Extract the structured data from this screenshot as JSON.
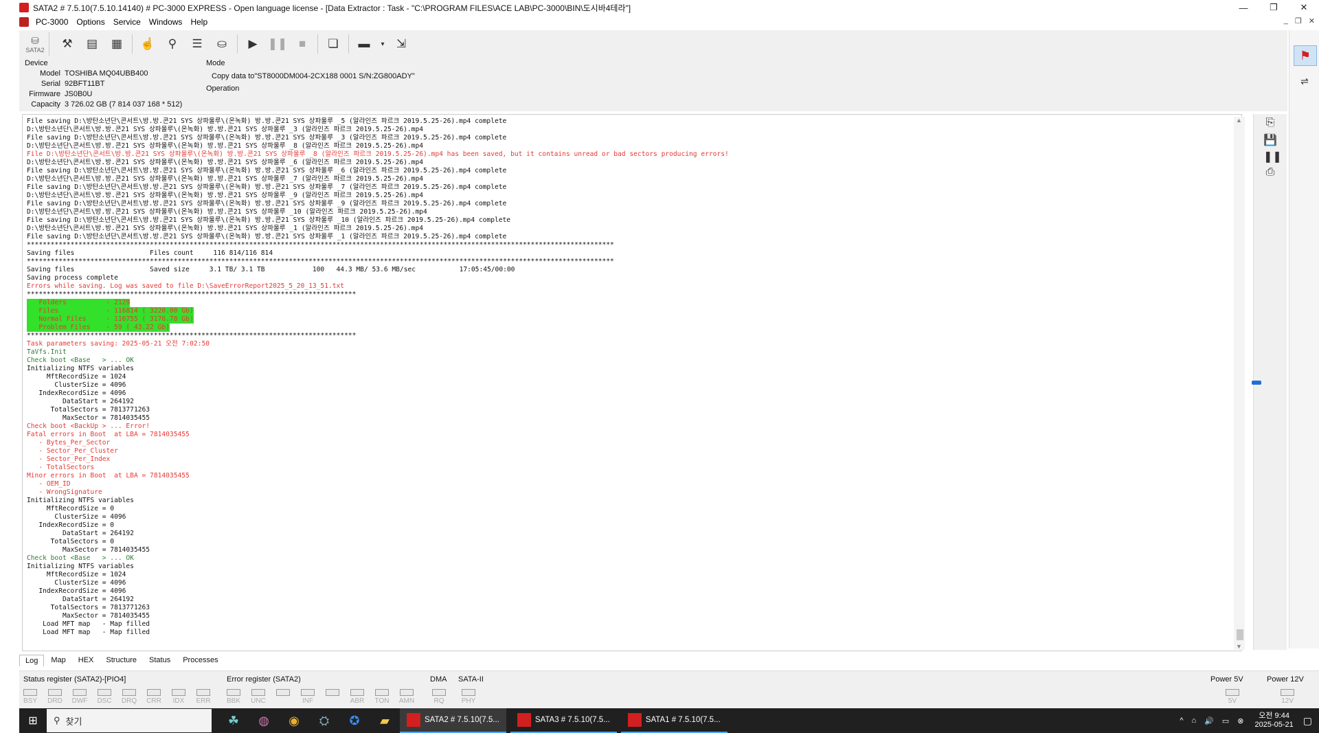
{
  "window": {
    "title": "SATA2 # 7.5.10(7.5.10.14140) # PC-3000 EXPRESS - Open language license - [Data Extractor : Task - \"C:\\PROGRAM FILES\\ACE LAB\\PC-3000\\BIN\\도시바4테라\"]",
    "controls": [
      "—",
      "❐",
      "✕"
    ]
  },
  "menu": {
    "items": [
      "PC-3000",
      "Options",
      "Service",
      "Windows",
      "Help"
    ],
    "right": [
      "_",
      "❐",
      "✕"
    ]
  },
  "toolbar": {
    "sata_label": "SATA2"
  },
  "device": {
    "heading": "Device",
    "model_label": "Model",
    "model": "TOSHIBA MQ04UBB400",
    "serial_label": "Serial",
    "serial": "92BFT11BT",
    "firmware_label": "Firmware",
    "firmware": "JS0B0U",
    "capacity_label": "Capacity",
    "capacity": "3 726.02 GB (7 814 037 168 * 512)"
  },
  "mode": {
    "heading": "Mode",
    "value": "Copy data to\"ST8000DM004-2CX188 0001 S/N:ZG800ADY\"",
    "operation_label": "Operation"
  },
  "log": [
    {
      "c": "b",
      "t": "File saving D:\\방탄소년단\\콘서트\\방.방.콘21 SYS 상파울루\\(온녹화) 방.방.콘21 SYS 상파울루 _5 (알라인즈 파르크 2019.5.25-26).mp4 complete"
    },
    {
      "c": "b",
      "t": "D:\\방탄소년단\\콘서트\\방.방.콘21 SYS 상파울루\\(온녹화) 방.방.콘21 SYS 상파울루 _3 (알라인즈 파르크 2019.5.25-26).mp4"
    },
    {
      "c": "b",
      "t": "File saving D:\\방탄소년단\\콘서트\\방.방.콘21 SYS 상파울루\\(온녹화) 방.방.콘21 SYS 상파울루 _3 (알라인즈 파르크 2019.5.25-26).mp4 complete"
    },
    {
      "c": "b",
      "t": "D:\\방탄소년단\\콘서트\\방.방.콘21 SYS 상파울루\\(온녹화) 방.방.콘21 SYS 상파울루 _8 (알라인즈 파르크 2019.5.25-26).mp4"
    },
    {
      "c": "r",
      "t": "File D:\\방탄소년단\\콘서트\\방.방.콘21 SYS 상파울루\\(온녹화) 방.방.콘21 SYS 상파울루 _8 (알라인즈 파르크 2019.5.25-26).mp4 has been saved, but it contains unread or bad sectors producing errors!"
    },
    {
      "c": "b",
      "t": "D:\\방탄소년단\\콘서트\\방.방.콘21 SYS 상파울루\\(온녹화) 방.방.콘21 SYS 상파울루 _6 (알라인즈 파르크 2019.5.25-26).mp4"
    },
    {
      "c": "b",
      "t": "File saving D:\\방탄소년단\\콘서트\\방.방.콘21 SYS 상파울루\\(온녹화) 방.방.콘21 SYS 상파울루 _6 (알라인즈 파르크 2019.5.25-26).mp4 complete"
    },
    {
      "c": "b",
      "t": "D:\\방탄소년단\\콘서트\\방.방.콘21 SYS 상파울루\\(온녹화) 방.방.콘21 SYS 상파울루 _7 (알라인즈 파르크 2019.5.25-26).mp4"
    },
    {
      "c": "b",
      "t": "File saving D:\\방탄소년단\\콘서트\\방.방.콘21 SYS 상파울루\\(온녹화) 방.방.콘21 SYS 상파울루 _7 (알라인즈 파르크 2019.5.25-26).mp4 complete"
    },
    {
      "c": "b",
      "t": "D:\\방탄소년단\\콘서트\\방.방.콘21 SYS 상파울루\\(온녹화) 방.방.콘21 SYS 상파울루 _9 (알라인즈 파르크 2019.5.25-26).mp4"
    },
    {
      "c": "b",
      "t": "File saving D:\\방탄소년단\\콘서트\\방.방.콘21 SYS 상파울루\\(온녹화) 방.방.콘21 SYS 상파울루 _9 (알라인즈 파르크 2019.5.25-26).mp4 complete"
    },
    {
      "c": "b",
      "t": "D:\\방탄소년단\\콘서트\\방.방.콘21 SYS 상파울루\\(온녹화) 방.방.콘21 SYS 상파울루 _10 (알라인즈 파르크 2019.5.25-26).mp4"
    },
    {
      "c": "b",
      "t": "File saving D:\\방탄소년단\\콘서트\\방.방.콘21 SYS 상파울루\\(온녹화) 방.방.콘21 SYS 상파울루 _10 (알라인즈 파르크 2019.5.25-26).mp4 complete"
    },
    {
      "c": "b",
      "t": "D:\\방탄소년단\\콘서트\\방.방.콘21 SYS 상파울루\\(온녹화) 방.방.콘21 SYS 상파울루 _1 (알라인즈 파르크 2019.5.25-26).mp4"
    },
    {
      "c": "b",
      "t": "File saving D:\\방탄소년단\\콘서트\\방.방.콘21 SYS 상파울루\\(온녹화) 방.방.콘21 SYS 상파울루 _1 (알라인즈 파르크 2019.5.25-26).mp4 complete"
    },
    {
      "c": "b",
      "t": "****************************************************************************************************************************************************"
    },
    {
      "c": "b",
      "t": "Saving files                   Files count     116 814/116 814"
    },
    {
      "c": "b",
      "t": "****************************************************************************************************************************************************"
    },
    {
      "c": "b",
      "t": "Saving files                   Saved size     3.1 TB/ 3.1 TB            100   44.3 MB/ 53.6 MB/sec           17:05:45/00:00"
    },
    {
      "c": "b",
      "t": "Saving process complete"
    },
    {
      "c": "r",
      "t": "Errors while saving. Log was saved to file D:\\SaveErrorReport2025_5_20_13_51.txt"
    },
    {
      "c": "b",
      "t": ""
    },
    {
      "c": "b",
      "t": "***********************************************************************************"
    },
    {
      "c": "r",
      "h": true,
      "t": "   Folders          - 2129"
    },
    {
      "c": "r",
      "h": true,
      "t": "   Files            - 116814 ( 3220.00 Gb)"
    },
    {
      "c": "r",
      "h": true,
      "t": "   Normal Files     - 116755 ( 3176.78 Gb)"
    },
    {
      "c": "r",
      "h": true,
      "t": "   Problem Files    - 59 ( 43.22 Gb)"
    },
    {
      "c": "b",
      "t": "***********************************************************************************"
    },
    {
      "c": "r",
      "t": "Task parameters saving: 2025-05-21 오전 7:02:50"
    },
    {
      "c": "g",
      "t": "TaVfs.Init"
    },
    {
      "c": "g",
      "t": "Check boot <Base   > ... OK"
    },
    {
      "c": "b",
      "t": "Initializing NTFS variables"
    },
    {
      "c": "b",
      "t": "     MftRecordSize = 1024"
    },
    {
      "c": "b",
      "t": "       ClusterSize = 4096"
    },
    {
      "c": "b",
      "t": "   IndexRecordSize = 4096"
    },
    {
      "c": "b",
      "t": "         DataStart = 264192"
    },
    {
      "c": "b",
      "t": "      TotalSectors = 7813771263"
    },
    {
      "c": "b",
      "t": "         MaxSector = 7814035455"
    },
    {
      "c": "r",
      "t": "Check boot <BackUp > ... Error!"
    },
    {
      "c": "r",
      "t": "Fatal errors in Boot  at LBA = 7814035455"
    },
    {
      "c": "r",
      "t": "   - Bytes_Per_Sector"
    },
    {
      "c": "r",
      "t": "   - Sector_Per_Cluster"
    },
    {
      "c": "r",
      "t": "   - Sector_Per_Index"
    },
    {
      "c": "r",
      "t": "   - TotalSectors"
    },
    {
      "c": "r",
      "t": "Minor errors in Boot  at LBA = 7814035455"
    },
    {
      "c": "r",
      "t": "   - OEM_ID"
    },
    {
      "c": "r",
      "t": "   - WrongSignature"
    },
    {
      "c": "b",
      "t": "Initializing NTFS variables"
    },
    {
      "c": "b",
      "t": "     MftRecordSize = 0"
    },
    {
      "c": "b",
      "t": "       ClusterSize = 4096"
    },
    {
      "c": "b",
      "t": "   IndexRecordSize = 0"
    },
    {
      "c": "b",
      "t": "         DataStart = 264192"
    },
    {
      "c": "b",
      "t": "      TotalSectors = 0"
    },
    {
      "c": "b",
      "t": "         MaxSector = 7814035455"
    },
    {
      "c": "g",
      "t": "Check boot <Base   > ... OK"
    },
    {
      "c": "b",
      "t": "Initializing NTFS variables"
    },
    {
      "c": "b",
      "t": "     MftRecordSize = 1024"
    },
    {
      "c": "b",
      "t": "       ClusterSize = 4096"
    },
    {
      "c": "b",
      "t": "   IndexRecordSize = 4096"
    },
    {
      "c": "b",
      "t": "         DataStart = 264192"
    },
    {
      "c": "b",
      "t": "      TotalSectors = 7813771263"
    },
    {
      "c": "b",
      "t": "         MaxSector = 7814035455"
    },
    {
      "c": "b",
      "t": "    Load MFT map   - Map filled"
    },
    {
      "c": "b",
      "t": "    Load MFT map   - Map filled"
    }
  ],
  "tabs": [
    "Log",
    "Map",
    "HEX",
    "Structure",
    "Status",
    "Processes"
  ],
  "status_register": {
    "title": "Status register (SATA2)-[PIO4]",
    "bits": [
      "BSY",
      "DRD",
      "DWF",
      "DSC",
      "DRQ",
      "CRR",
      "IDX",
      "ERR"
    ]
  },
  "error_register": {
    "title": "Error register (SATA2)",
    "bits": [
      "BBK",
      "UNC",
      "",
      "INF",
      "",
      "ABR",
      "TON",
      "AMN"
    ]
  },
  "dma": {
    "title": "DMA",
    "bits": [
      "RQ"
    ]
  },
  "sata2": {
    "title": "SATA-II",
    "bits": [
      "PHY"
    ]
  },
  "power5": {
    "title": "Power 5V",
    "bits": [
      "5V"
    ]
  },
  "power12": {
    "title": "Power 12V",
    "bits": [
      "12V"
    ]
  },
  "taskbar": {
    "search_placeholder": "찾기",
    "apps": [
      "SATA2 # 7.5.10(7.5...",
      "SATA3 # 7.5.10(7.5...",
      "SATA1 # 7.5.10(7.5..."
    ],
    "time": "오전 9:44",
    "date": "2025-05-21",
    "tray_icons": [
      "^",
      "⌂",
      "🔊",
      "▭",
      "⊗"
    ]
  },
  "colors": {
    "error": "#e53935",
    "ok": "#2e7d32",
    "highlight": "#33e02a",
    "taskbar": "#202020"
  }
}
